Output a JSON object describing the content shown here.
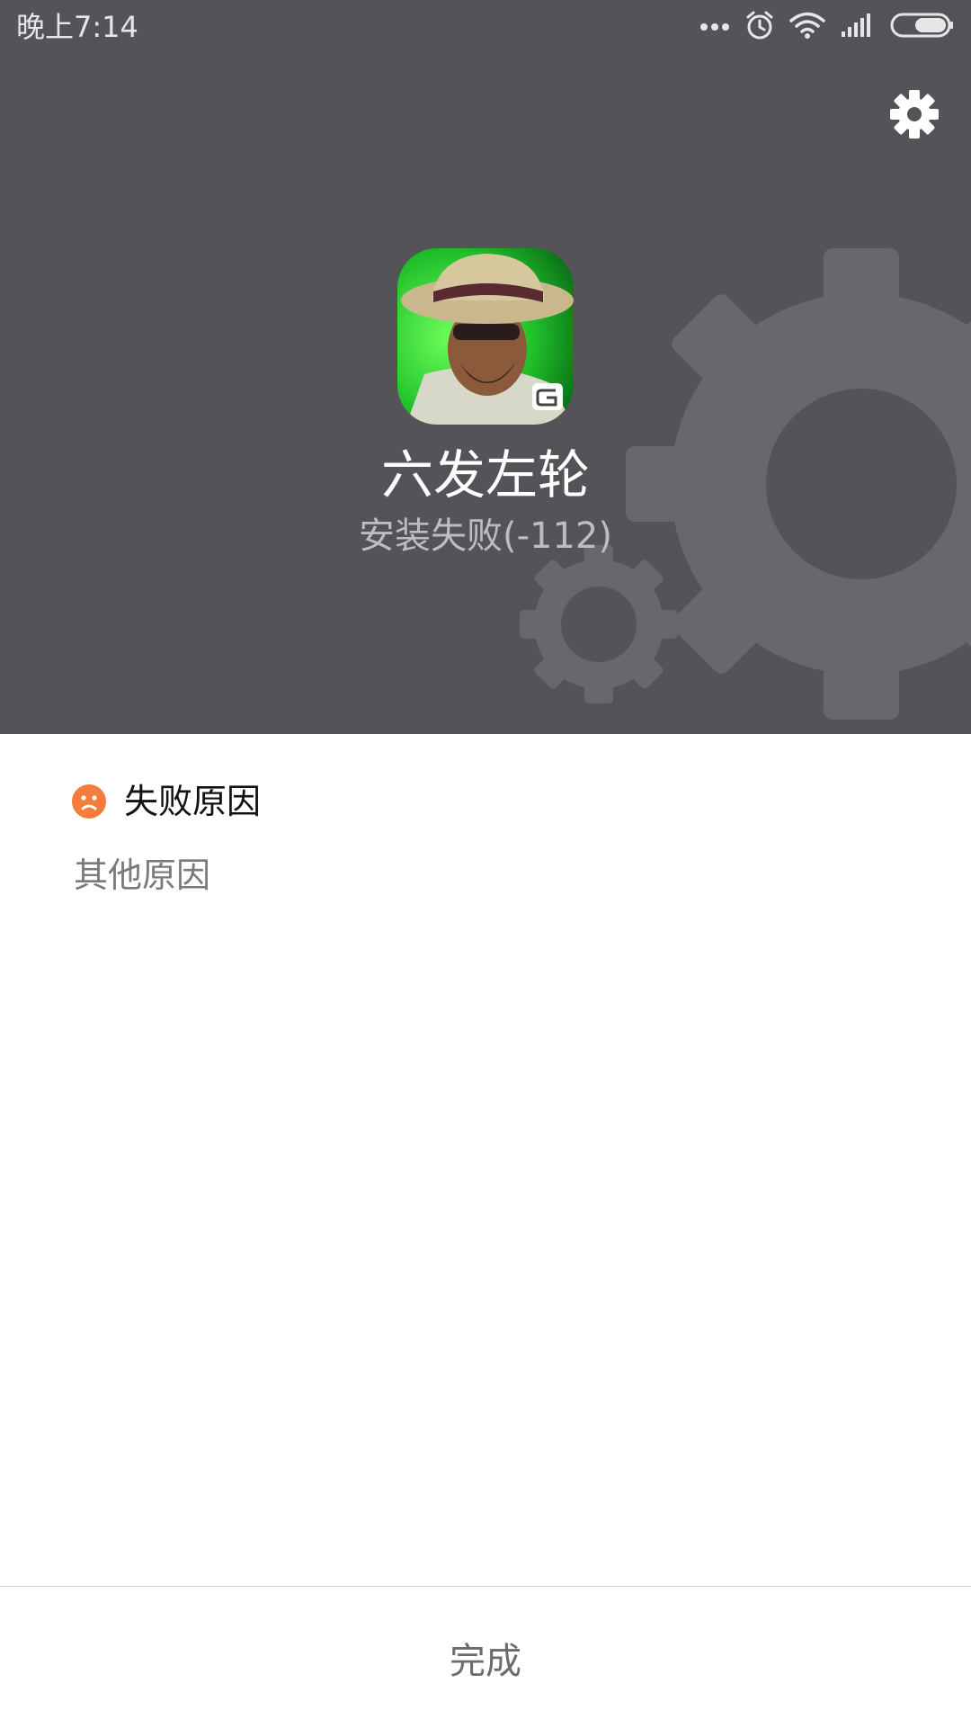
{
  "status_bar": {
    "time": "晚上7:14",
    "icons": [
      "more-dots-icon",
      "alarm-icon",
      "wifi-icon",
      "signal-icon",
      "battery-icon"
    ]
  },
  "header": {
    "settings_icon": "gear-icon",
    "app_name": "六发左轮",
    "install_status": "安装失败(-112)",
    "background_color": "#545458"
  },
  "reason": {
    "icon": "sad-face-icon",
    "icon_color": "#f57c3a",
    "title": "失败原因",
    "detail": "其他原因"
  },
  "footer": {
    "done_label": "完成"
  }
}
